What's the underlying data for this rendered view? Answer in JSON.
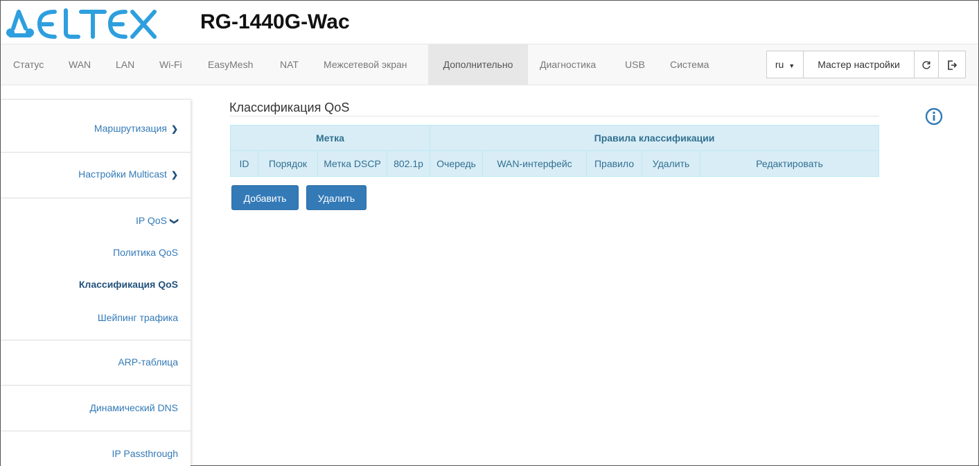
{
  "header": {
    "logo_text": "ELTEX",
    "model": "RG-1440G-Wac"
  },
  "nav": {
    "items": [
      "Статус",
      "WAN",
      "LAN",
      "Wi-Fi",
      "EasyMesh",
      "NAT",
      "Межсетевой экран",
      "Дополнительно",
      "Диагностика",
      "USB",
      "Система"
    ],
    "active": "Дополнительно",
    "language": "ru",
    "wizard_label": "Мастер настройки",
    "refresh_icon": "refresh-icon",
    "logout_icon": "logout-icon"
  },
  "sidebar": {
    "routing": "Маршрутизация",
    "multicast": "Настройки Multicast",
    "ipqos": "IP QoS",
    "qos_policy": "Политика QoS",
    "qos_class": "Классификация QoS",
    "shaping": "Шейпинг трафика",
    "arp": "ARP-таблица",
    "ddns": "Динамический DNS",
    "passthrough": "IP Passthrough"
  },
  "main": {
    "title": "Классификация QoS",
    "table": {
      "group_headers": [
        "Метка",
        "Правила классификации"
      ],
      "columns": [
        "ID",
        "Порядок",
        "Метка DSCP",
        "802.1p",
        "Очередь",
        "WAN-интерфейс",
        "Правило",
        "Удалить",
        "Редактировать"
      ],
      "rows": []
    },
    "add_button": "Добавить",
    "delete_button": "Удалить"
  },
  "colors": {
    "accent": "#337ab7",
    "logo": "#2e9fde",
    "table_bg": "#d9edf7",
    "table_text": "#31708f",
    "active_nav_bg": "#e7e7e7"
  }
}
